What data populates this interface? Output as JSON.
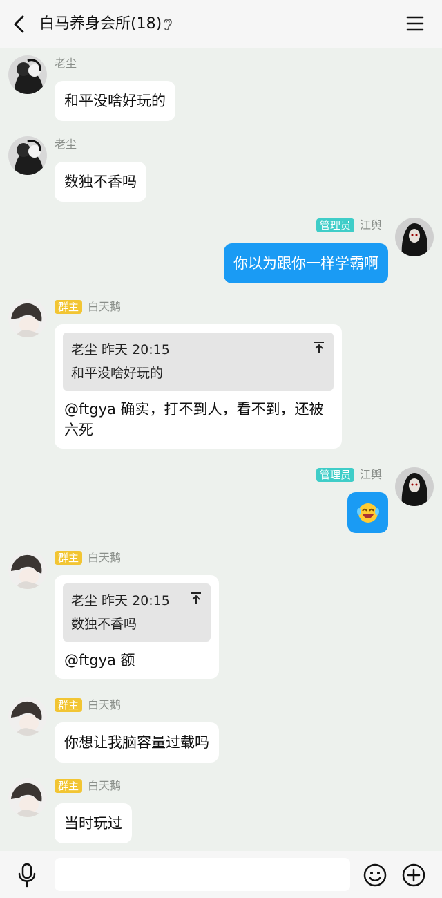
{
  "header": {
    "title": "白马养身会所(18)"
  },
  "messages": [
    {
      "sender": "老尘",
      "text": "和平没啥好玩的"
    },
    {
      "sender": "老尘",
      "text": "数独不香吗"
    },
    {
      "role_badge": "管理员",
      "sender": "江舆",
      "text": "你以为跟你一样学霸啊"
    },
    {
      "role_badge": "群主",
      "sender": "白天鹅",
      "quote_meta": "老尘  昨天 20:15",
      "quote_text": "和平没啥好玩的",
      "text": "@ftgya 确实，打不到人，看不到，还被六死"
    },
    {
      "role_badge": "管理员",
      "sender": "江舆",
      "emoji": "laugh-cry-emoji"
    },
    {
      "role_badge": "群主",
      "sender": "白天鹅",
      "quote_meta": "老尘  昨天 20:15",
      "quote_text": "数独不香吗",
      "text": "@ftgya 额"
    },
    {
      "role_badge": "群主",
      "sender": "白天鹅",
      "text": "你想让我脑容量过载吗"
    },
    {
      "role_badge": "群主",
      "sender": "白天鹅",
      "text": "当时玩过"
    }
  ],
  "input": {
    "placeholder": ""
  },
  "icons": {
    "back": "chevron-left-icon",
    "ear": "ear-icon",
    "menu": "menu-icon",
    "mic": "microphone-icon",
    "emoji": "emoji-icon",
    "plus": "plus-icon"
  },
  "colors": {
    "outgoing_bubble": "#1a9bf4",
    "owner_badge": "#f2c533",
    "admin_badge": "#3fcdc8",
    "background": "#edf1ed"
  }
}
